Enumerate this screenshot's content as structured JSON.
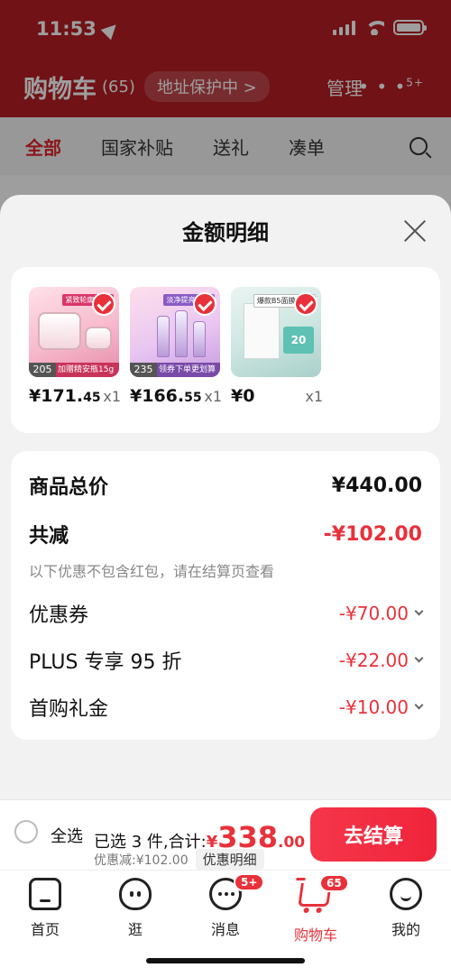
{
  "status_bar": {
    "time": "11:53"
  },
  "background_header": {
    "title": "购物车",
    "count": "(65)",
    "address_chip": "地址保护中 >",
    "manage": "管理",
    "more": "• • •",
    "more_badge": "5+"
  },
  "background_tabs": [
    "全部",
    "国家补贴",
    "送礼",
    "凑单"
  ],
  "sheet": {
    "title": "金额明细",
    "products": [
      {
        "price_int": "¥171.",
        "price_dec": "45",
        "qty": "x1",
        "badge": "205",
        "banner": "加赠精安瓶15g",
        "label": "紧致轮廓 柔滑"
      },
      {
        "price_int": "¥166.",
        "price_dec": "55",
        "qty": "x1",
        "badge": "235",
        "banner": "领券下单更划算",
        "label": "淡净提亮 淡纹"
      },
      {
        "price_int": "¥0",
        "price_dec": "",
        "qty": "x1",
        "badge": "",
        "banner": "",
        "label": "爆款B5面膜 下单",
        "box_text": "20"
      }
    ],
    "summary": {
      "total_label": "商品总价",
      "total_value": "¥440.00",
      "reduce_label": "共减",
      "reduce_value": "-¥102.00",
      "note": "以下优惠不包含红包，请在结算页查看",
      "items": [
        {
          "label": "优惠券",
          "value": "-¥70.00"
        },
        {
          "label": "PLUS 专享 95 折",
          "value": "-¥22.00"
        },
        {
          "label": "首购礼金",
          "value": "-¥10.00"
        }
      ]
    }
  },
  "checkout": {
    "select_all": "全选",
    "selected_text": "已选 3 件,合计:",
    "total_symbol": "¥",
    "total_int": "338",
    "total_dec": ".00",
    "discount": "优惠减:¥102.00",
    "detail_chip": "优惠明细",
    "button": "去结算"
  },
  "tabbar": {
    "items": [
      {
        "label": "首页",
        "icon": "home-icon"
      },
      {
        "label": "逛",
        "icon": "browse-icon"
      },
      {
        "label": "消息",
        "icon": "message-icon",
        "badge": "5+"
      },
      {
        "label": "购物车",
        "icon": "cart-icon",
        "badge": "65"
      },
      {
        "label": "我的",
        "icon": "profile-icon"
      }
    ]
  },
  "colors": {
    "accent": "#e8313a",
    "header_bg": "#b51e24"
  }
}
